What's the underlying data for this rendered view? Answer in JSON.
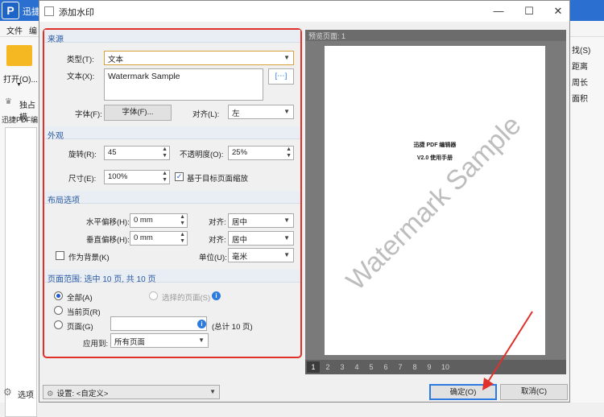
{
  "background_app": {
    "title": "迅捷",
    "menu": [
      "文件",
      "编"
    ],
    "open_label": "打开(O)...",
    "toolbar_item": "独占模",
    "tab_label": "迅捷PDF编",
    "bottom_label": "选项",
    "right_items": [
      "找(S)",
      "距离",
      "周长",
      "面积"
    ]
  },
  "dialog": {
    "title": "添加水印",
    "window_controls": [
      "—",
      "☐",
      "✕"
    ],
    "source": {
      "header": "来源",
      "type_label": "类型(T):",
      "type_value": "文本",
      "text_label": "文本(X):",
      "text_value": "Watermark Sample",
      "font_label": "字体(F):",
      "font_button": "字体(F)...",
      "align_label": "对齐(L):",
      "align_value": "左",
      "insert_btn": "[⋯]"
    },
    "appearance": {
      "header": "外观",
      "rotation_label": "旋转(R):",
      "rotation_value": "45",
      "opacity_label": "不透明度(O):",
      "opacity_value": "25%",
      "size_label": "尺寸(E):",
      "size_value": "100%",
      "scale_label": "基于目标页面缩放",
      "scale_checked": true
    },
    "layout": {
      "header": "布局选项",
      "h_offset_label": "水平偏移(H):",
      "h_offset_value": "0 mm",
      "h_align_label": "对齐:",
      "h_align_value": "居中",
      "v_offset_label": "垂直偏移(H):",
      "v_offset_value": "0 mm",
      "v_align_label": "对齐:",
      "v_align_value": "居中",
      "background_label": "作为背景(K)",
      "unit_label": "单位(U):",
      "unit_value": "毫米"
    },
    "page_range": {
      "header": "页面范围: 选中 10 页, 共 10 页",
      "all_label": "全部(A)",
      "selected_label": "选择的页面(S)",
      "current_label": "当前页(R)",
      "pages_label": "页面(G)",
      "total_label": "(总计 10 页)",
      "apply_label": "应用到:",
      "apply_value": "所有页面"
    },
    "preview": {
      "header": "预览页面: 1",
      "doc_title": "迅捷 PDF 编辑器",
      "doc_subtitle": "V2.0 使用手册",
      "watermark": "Watermark Sample",
      "pages": [
        "1",
        "2",
        "3",
        "4",
        "5",
        "6",
        "7",
        "8",
        "9",
        "10"
      ],
      "active_page": "1"
    },
    "footer": {
      "settings_label": "设置:",
      "settings_value": "<自定义>",
      "ok_label": "确定(O)",
      "cancel_label": "取消(C)"
    }
  },
  "colors": {
    "highlight": "#e0302a",
    "accent": "#2d7be0"
  }
}
